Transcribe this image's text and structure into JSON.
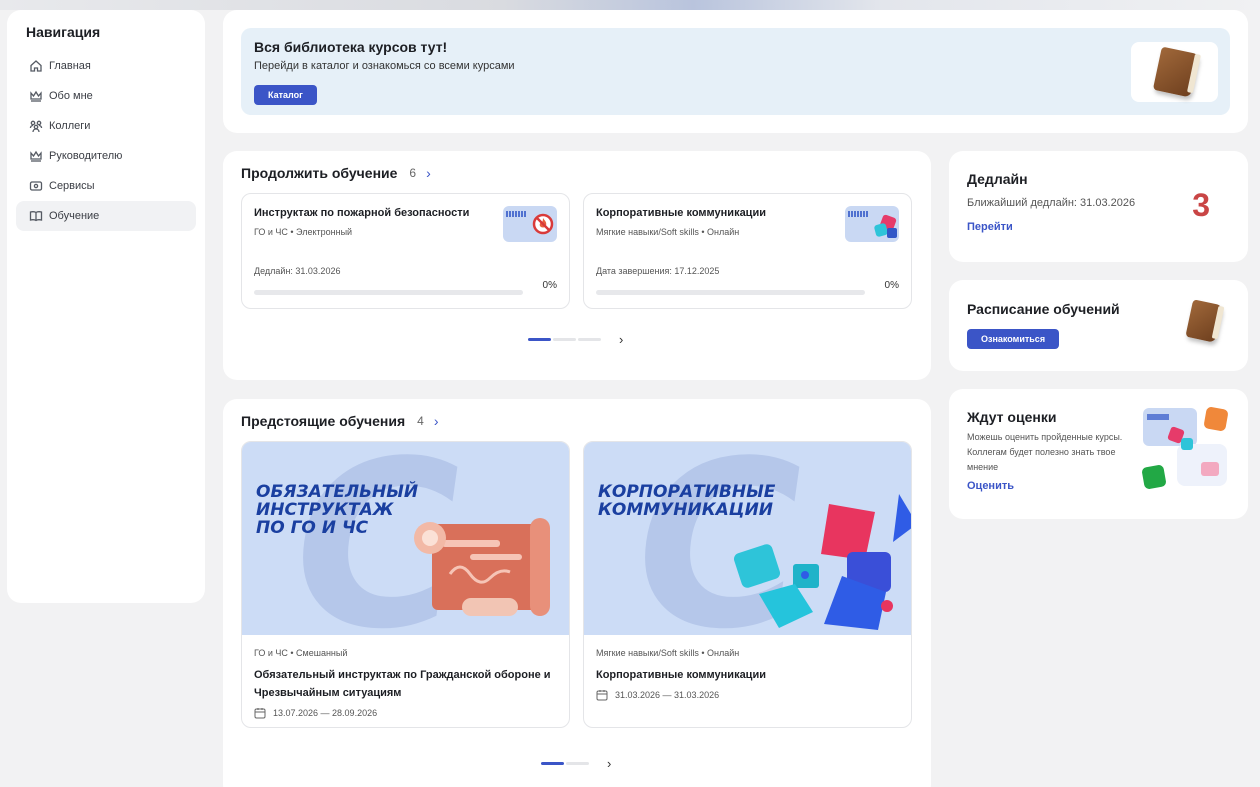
{
  "nav": {
    "title": "Навигация",
    "items": [
      {
        "label": "Главная"
      },
      {
        "label": "Обо мне"
      },
      {
        "label": "Коллеги"
      },
      {
        "label": "Руководителю"
      },
      {
        "label": "Сервисы"
      },
      {
        "label": "Обучение"
      }
    ]
  },
  "banner": {
    "title": "Вся библиотека курсов тут!",
    "subtitle": "Перейди в каталог и ознакомься со всеми курсами",
    "button": "Каталог"
  },
  "continue": {
    "title": "Продолжить обучение",
    "count": "6",
    "courses": [
      {
        "title": "Инструктаж по пожарной безопасности",
        "meta": "ГО и ЧС • Электронный",
        "date": "Дедлайн: 31.03.2026",
        "progress": "0%"
      },
      {
        "title": "Корпоративные коммуникации",
        "meta": "Мягкие навыки/Soft skills • Онлайн",
        "date": "Дата завершения: 17.12.2025",
        "progress": "0%"
      }
    ]
  },
  "upcoming": {
    "title": "Предстоящие обучения",
    "count": "4",
    "items": [
      {
        "img_text": "ОБЯЗАТЕЛЬНЫЙ\nИНСТРУКТАЖ\nПО ГО И ЧС",
        "meta": "ГО и ЧС • Смешанный",
        "title": "Обязательный инструктаж по Гражданской обороне и Чрезвычайным ситуациям",
        "dates": "13.07.2026 — 28.09.2026"
      },
      {
        "img_text": "КОРПОРАТИВНЫЕ\nКОММУНИКАЦИИ",
        "meta": "Мягкие навыки/Soft skills • Онлайн",
        "title": "Корпоративные коммуникации",
        "dates": "31.03.2026 — 31.03.2026"
      }
    ]
  },
  "deadline": {
    "title": "Дедлайн",
    "text": "Ближайший дедлайн: 31.03.2026",
    "link": "Перейти",
    "count": "3"
  },
  "schedule": {
    "title": "Расписание обучений",
    "button": "Ознакомиться"
  },
  "ratings": {
    "title": "Ждут оценки",
    "text": "Можешь оценить пройденные курсы. Коллегам будет полезно знать твое мнение",
    "link": "Оценить"
  },
  "colors": {
    "accent": "#3b55c7",
    "deadline_number": "#c94545",
    "banner_bg": "#e6f0f8"
  }
}
